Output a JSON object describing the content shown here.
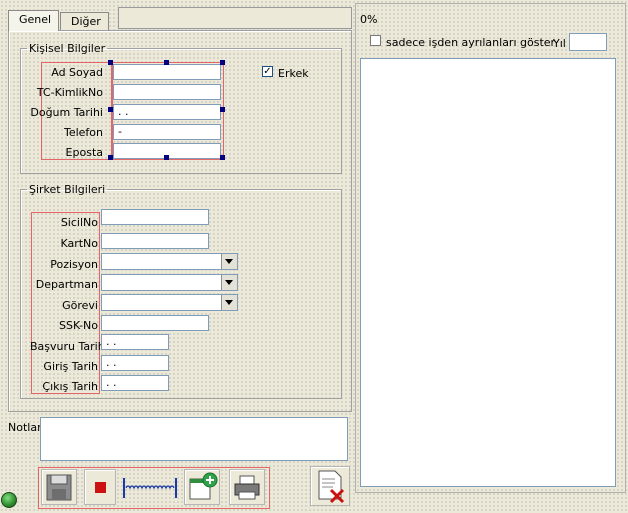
{
  "tabs": [
    {
      "label": "Genel",
      "active": true
    },
    {
      "label": "Diğer",
      "active": false
    }
  ],
  "personal": {
    "legend": "Kişisel Bilgiler",
    "fields": [
      {
        "label": "Ad Soyad",
        "value": ""
      },
      {
        "label": "TC-KimlikNo",
        "value": ""
      },
      {
        "label": "Doğum Tarihi",
        "value": " . ."
      },
      {
        "label": "Telefon",
        "value": " -"
      },
      {
        "label": "Eposta",
        "value": ""
      }
    ],
    "gender": {
      "label": "Erkek",
      "checked": true
    }
  },
  "company": {
    "legend": "Şirket Bilgileri",
    "fields": [
      {
        "label": "SicilNo",
        "value": "",
        "type": "text"
      },
      {
        "label": "KartNo",
        "value": "",
        "type": "text"
      },
      {
        "label": "Pozisyon",
        "value": "",
        "type": "combo"
      },
      {
        "label": "Departman",
        "value": "",
        "type": "combo"
      },
      {
        "label": "Görevi",
        "value": "",
        "type": "combo"
      },
      {
        "label": "SSK-No",
        "value": "",
        "type": "text"
      },
      {
        "label": "Başvuru Tarih",
        "value": " . .",
        "type": "text"
      },
      {
        "label": "Giriş Tarih",
        "value": " . .",
        "type": "text"
      },
      {
        "label": "Çıkış Tarih",
        "value": " . .",
        "type": "text"
      }
    ]
  },
  "notes": {
    "label": "Notlar",
    "value": ""
  },
  "right": {
    "progress": "0%",
    "filter_label": "sadece işden ayrılanları göster",
    "year_label": "Yıl",
    "year_value": ""
  },
  "toolbar": {
    "buttons": [
      "save-icon",
      "stop-icon",
      "progress-spring-icon",
      "add-document-icon",
      "printer-icon",
      "delete-document-icon"
    ]
  },
  "colors": {
    "accent_red": "#e56666",
    "handle_blue": "#000080",
    "status_green": "#2e8b2e"
  }
}
